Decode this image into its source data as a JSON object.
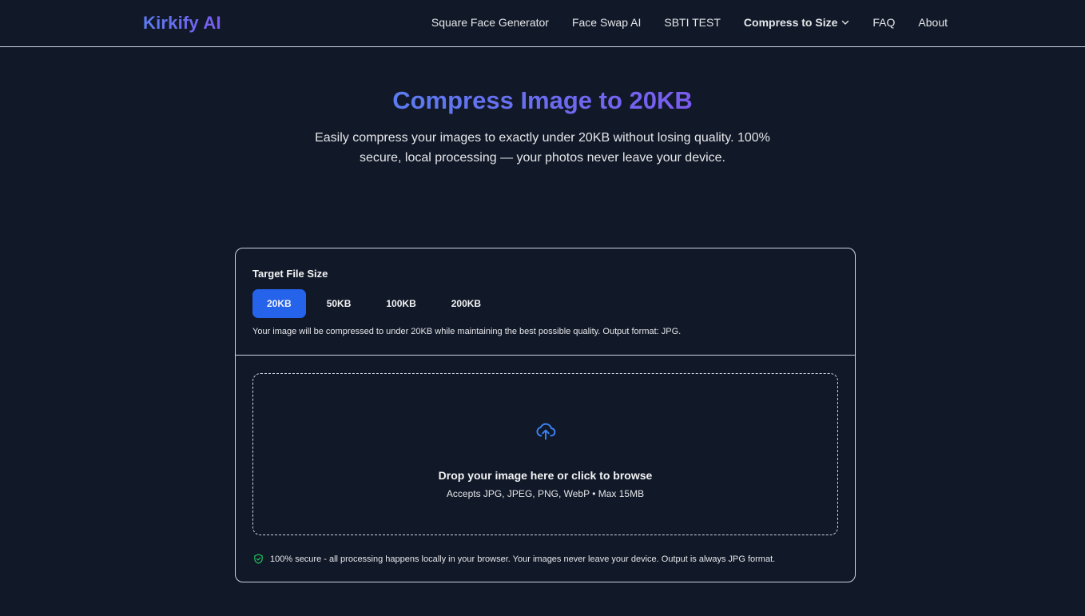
{
  "header": {
    "logo": "Kirkify AI",
    "nav": [
      {
        "label": "Square Face Generator"
      },
      {
        "label": "Face Swap AI"
      },
      {
        "label": "SBTI TEST"
      },
      {
        "label": "Compress to Size"
      },
      {
        "label": "FAQ"
      },
      {
        "label": "About"
      }
    ]
  },
  "hero": {
    "title": "Compress Image to 20KB",
    "subtitle": "Easily compress your images to exactly under 20KB without losing quality. 100% secure, local processing — your photos never leave your device."
  },
  "card": {
    "target_label": "Target File Size",
    "sizes": [
      {
        "label": "20KB",
        "selected": true
      },
      {
        "label": "50KB",
        "selected": false
      },
      {
        "label": "100KB",
        "selected": false
      },
      {
        "label": "200KB",
        "selected": false
      }
    ],
    "note": "Your image will be compressed to under 20KB while maintaining the best possible quality. Output format: JPG.",
    "dropzone": {
      "title": "Drop your image here or click to browse",
      "subtitle": "Accepts JPG, JPEG, PNG, WebP • Max 15MB"
    },
    "secure_text": "100% secure - all processing happens locally in your browser. Your images never leave your device. Output is always JPG format."
  },
  "colors": {
    "background": "#111827",
    "accent": "#2563eb",
    "icon_blue": "#3b82f6",
    "shield_green": "#22c55e"
  },
  "icons": {
    "nav_dropdown": "chevron-down-icon",
    "upload": "cloud-upload-icon",
    "secure": "shield-check-icon"
  }
}
